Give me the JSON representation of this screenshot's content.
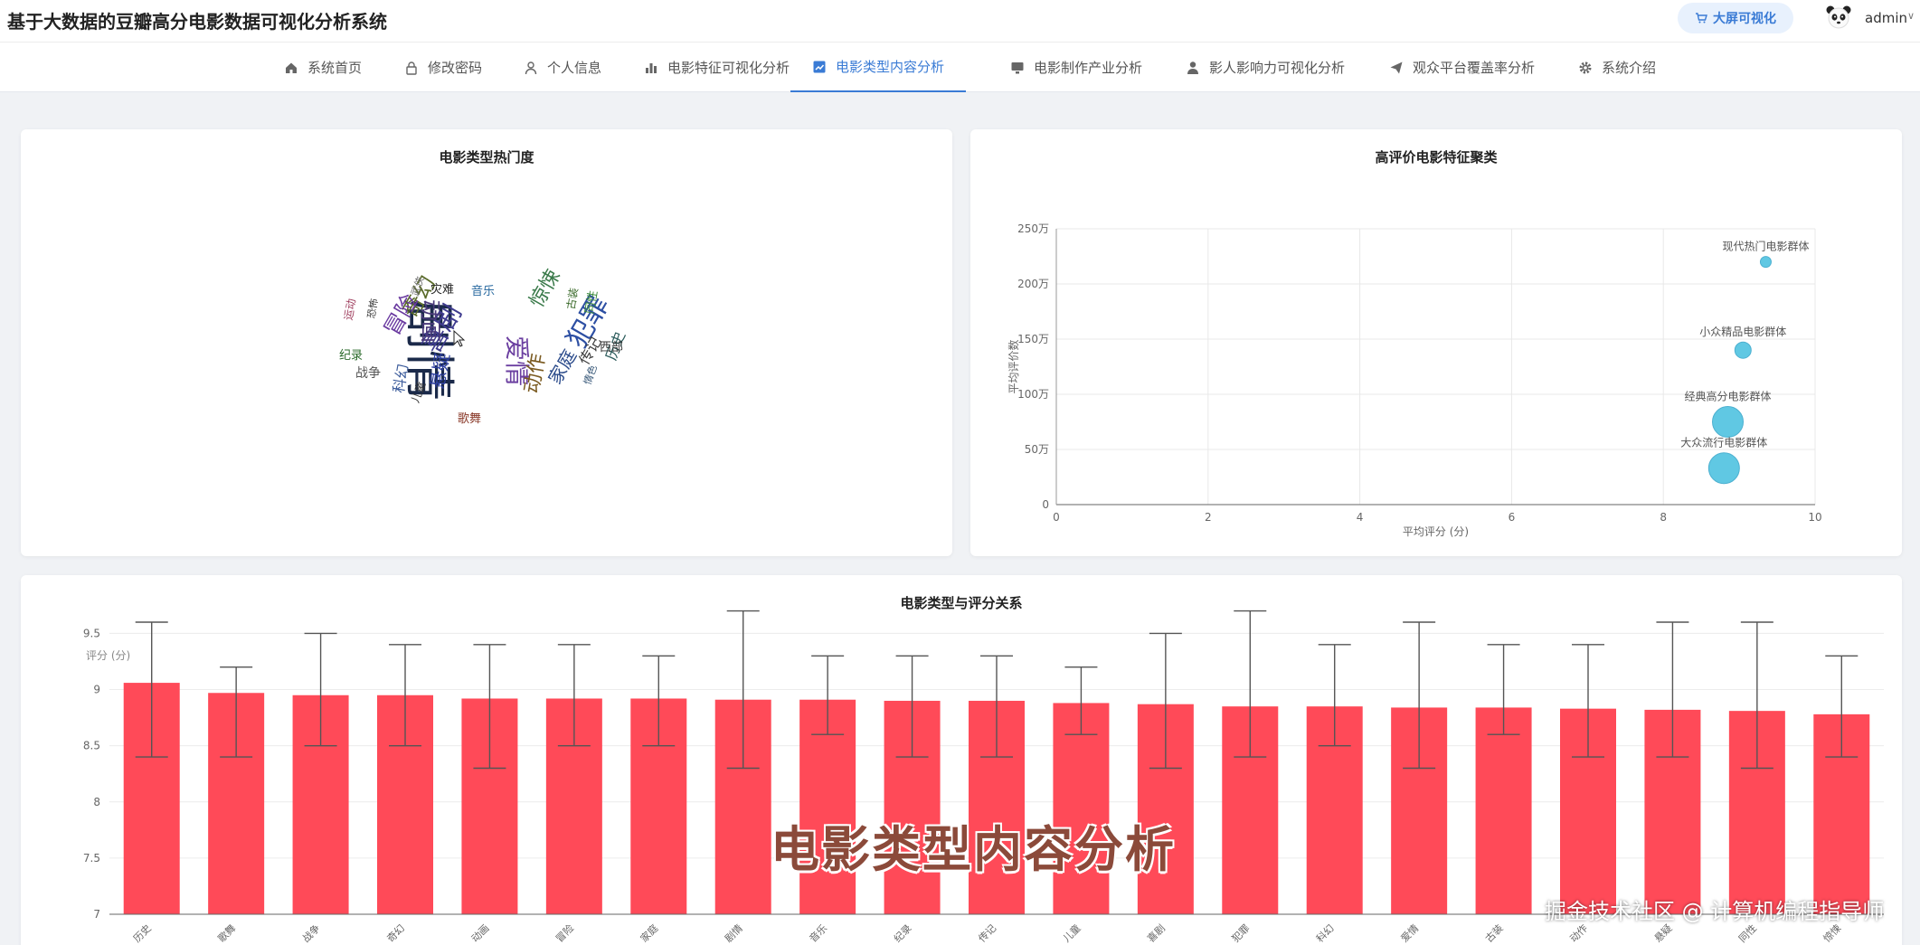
{
  "app": {
    "title": "基于大数据的豆瓣高分电影数据可视化分析系统",
    "bigscreen_label": "大屏可视化",
    "user_name": "admin",
    "user_caret": "∨"
  },
  "nav": {
    "items": [
      {
        "label": "系统首页",
        "icon": "home-icon"
      },
      {
        "label": "修改密码",
        "icon": "lock-icon"
      },
      {
        "label": "个人信息",
        "icon": "user-icon"
      },
      {
        "label": "电影特征可视化分析",
        "icon": "bar-chart-icon"
      },
      {
        "label": "电影类型内容分析",
        "icon": "line-chart-icon",
        "active": true
      },
      {
        "label": "电影制作产业分析",
        "icon": "monitor-icon"
      },
      {
        "label": "影人影响力可视化分析",
        "icon": "person-icon"
      },
      {
        "label": "观众平台覆盖率分析",
        "icon": "send-icon"
      },
      {
        "label": "系统介绍",
        "icon": "gear-icon"
      }
    ]
  },
  "wordcloud": {
    "title": "电影类型热门度",
    "words": [
      "剧情",
      "犯罪",
      "爱情",
      "喜剧",
      "动画",
      "奇幻",
      "冒险",
      "悬疑",
      "动作",
      "惊悚",
      "家庭",
      "传记",
      "历史",
      "灾难",
      "音乐",
      "纪录",
      "战争",
      "西部",
      "同性",
      "古装",
      "科幻",
      "歌舞",
      "运动",
      "恐怖",
      "武侠",
      "情色",
      "儿童"
    ]
  },
  "cluster": {
    "title": "高评价电影特征聚类"
  },
  "colors": {
    "accent": "#3a7bd5",
    "bar": "#ff4a58",
    "bubble": "#4fc3e0"
  },
  "overlay": {
    "title": "电影类型内容分析",
    "watermark": "掘金技术社区 @ 计算机编程指导师"
  },
  "chart_data": [
    {
      "type": "scatter",
      "title": "高评价电影特征聚类",
      "xlabel": "平均评分 (分)",
      "ylabel": "平均评价数",
      "xlim": [
        0,
        10
      ],
      "ylim": [
        0,
        2500000
      ],
      "x_ticks": [
        "0",
        "2",
        "4",
        "6",
        "8",
        "10"
      ],
      "y_ticks": [
        "0",
        "50万",
        "100万",
        "150万",
        "200万",
        "250万"
      ],
      "grid": true,
      "points": [
        {
          "name": "现代热门电影群体",
          "x": 9.35,
          "y": 2200000,
          "size": 1
        },
        {
          "name": "小众精品电影群体",
          "x": 9.05,
          "y": 1400000,
          "size": 2
        },
        {
          "name": "经典高分电影群体",
          "x": 8.85,
          "y": 750000,
          "size": 4
        },
        {
          "name": "大众流行电影群体",
          "x": 8.8,
          "y": 330000,
          "size": 4
        }
      ]
    },
    {
      "type": "bar",
      "title": "电影类型与评分关系",
      "ylabel": "评分 (分)",
      "ylim": [
        7,
        9.6
      ],
      "y_ticks": [
        "7",
        "7.5",
        "8",
        "8.5",
        "9",
        "9.5"
      ],
      "grid": true,
      "categories": [
        "历史",
        "歌舞",
        "战争",
        "奇幻",
        "动画",
        "冒险",
        "家庭",
        "剧情",
        "音乐",
        "纪录",
        "传记",
        "儿童",
        "喜剧",
        "犯罪",
        "科幻",
        "爱情",
        "古装",
        "动作",
        "悬疑",
        "同性",
        "惊悚"
      ],
      "values": [
        9.06,
        8.97,
        8.95,
        8.95,
        8.92,
        8.92,
        8.92,
        8.91,
        8.91,
        8.9,
        8.9,
        8.88,
        8.87,
        8.85,
        8.85,
        8.84,
        8.84,
        8.83,
        8.82,
        8.81,
        8.78
      ],
      "error_low": [
        8.4,
        8.4,
        8.5,
        8.5,
        8.3,
        8.5,
        8.5,
        8.3,
        8.6,
        8.4,
        8.4,
        8.6,
        8.3,
        8.4,
        8.5,
        8.3,
        8.6,
        8.4,
        8.4,
        8.3,
        8.4
      ],
      "error_high": [
        9.6,
        9.2,
        9.5,
        9.4,
        9.4,
        9.4,
        9.3,
        9.7,
        9.3,
        9.3,
        9.3,
        9.2,
        9.5,
        9.7,
        9.4,
        9.6,
        9.4,
        9.4,
        9.6,
        9.6,
        9.3
      ]
    }
  ]
}
